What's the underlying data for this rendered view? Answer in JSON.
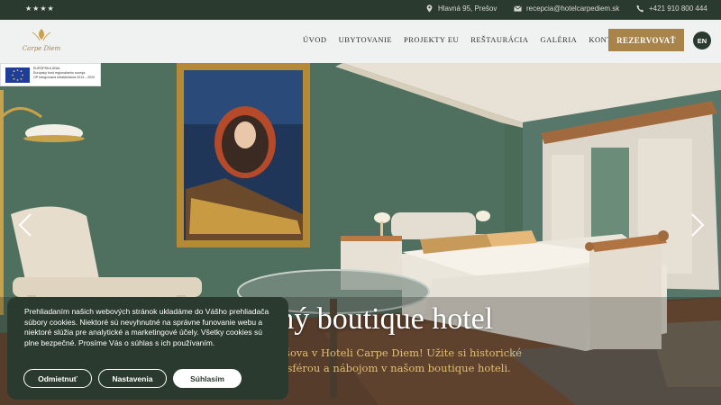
{
  "topbar": {
    "stars": "★★★★",
    "address": "Hlavná 95, Prešov",
    "email": "recepcia@hotelcarpediem.sk",
    "phone": "+421 910 800 444"
  },
  "brand": {
    "logo_text": "Carpe Diem"
  },
  "nav": {
    "items": [
      "ÚVOD",
      "UBYTOVANIE",
      "PROJEKTY EU",
      "REŠTAURÁCIA",
      "GALÉRIA",
      "KONTAKT"
    ],
    "reserve_label": "REZERVOVAŤ",
    "language": "EN"
  },
  "eu_badge": {
    "line1": "EURÓPSKA ÚNIA",
    "line2": "Európsky fond regionálneho rozvoja",
    "line3": "OP Integrovaná infraštruktúra 2014 – 2020"
  },
  "hero": {
    "title": "sný boutique hotel",
    "subtitle": "Prešova v Hoteli Carpe Diem! Užite si historické tmosférou a nábojom v našom boutique hoteli."
  },
  "cookie": {
    "text": "Prehliadaním našich webových stránok ukladáme do Vášho prehliadača súbory cookies. Niektoré sú nevyhnutné na správne funovanie webu a niektoré slúžia pre analytické a marketingové účely. Všetky cookies sú plne bezpečné. Prosíme Vás o súhlas s ich používaním.",
    "reject_label": "Odmietnuť",
    "settings_label": "Nastavenia",
    "accept_label": "Súhlasím"
  },
  "colors": {
    "dark_green": "#2b3a2f",
    "gold": "#a8834a",
    "wall_green": "#4e6e5c"
  }
}
